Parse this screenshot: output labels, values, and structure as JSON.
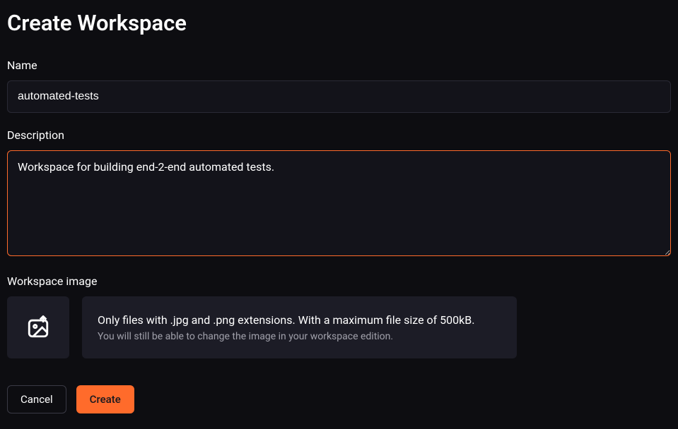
{
  "title": "Create Workspace",
  "form": {
    "name": {
      "label": "Name",
      "value": "automated-tests"
    },
    "description": {
      "label": "Description",
      "value": "Workspace for building end-2-end automated tests."
    },
    "workspaceImage": {
      "label": "Workspace image",
      "infoTitle": "Only files with .jpg and .png extensions. With a maximum file size of 500kB.",
      "infoSubtitle": "You will still be able to change the image in your workspace edition."
    }
  },
  "buttons": {
    "cancel": "Cancel",
    "create": "Create"
  }
}
